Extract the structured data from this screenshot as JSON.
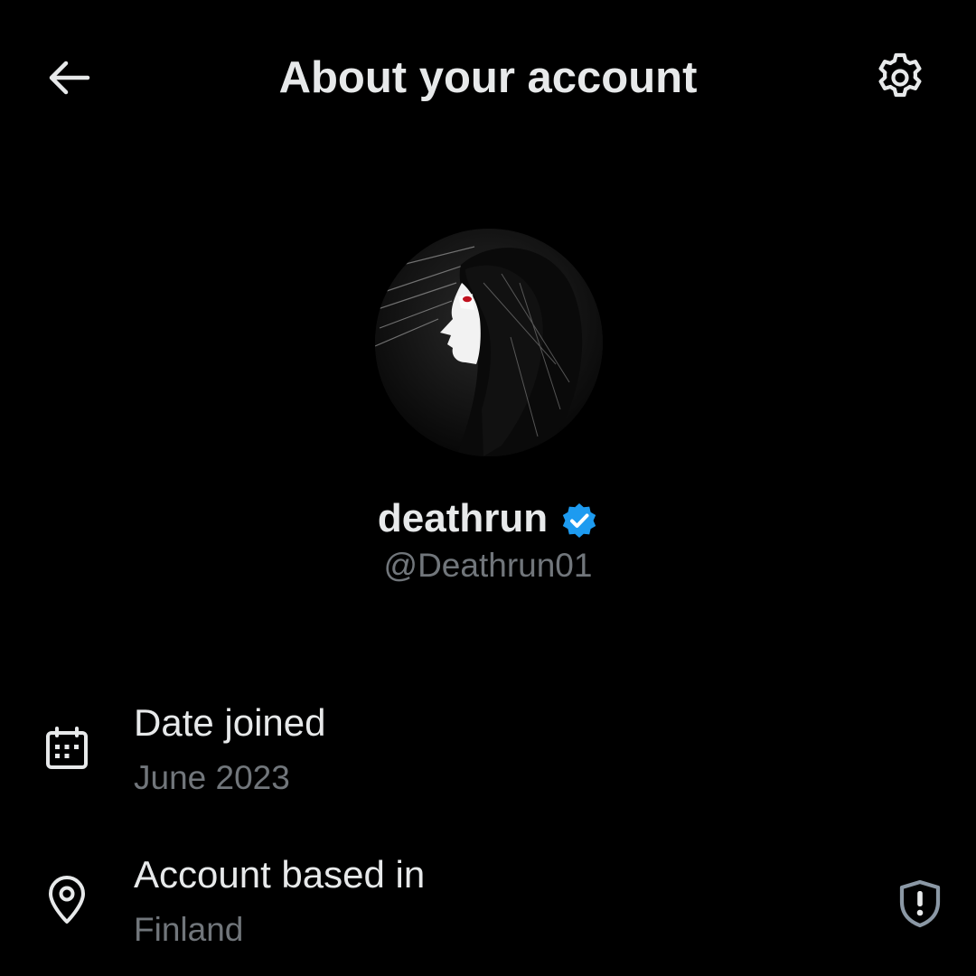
{
  "header": {
    "title": "About your account",
    "back_icon": "arrow-left-icon",
    "settings_icon": "gear-icon"
  },
  "profile": {
    "display_name": "deathrun",
    "handle": "@Deathrun01",
    "verified": true,
    "verified_color": "#1d9bf0",
    "avatar_icon": "profile-avatar"
  },
  "info": {
    "date_joined": {
      "label": "Date joined",
      "value": "June 2023",
      "icon": "calendar-icon"
    },
    "account_based_in": {
      "label": "Account based in",
      "value": "Finland",
      "icon": "location-pin-icon",
      "action_icon": "shield-alert-icon"
    }
  },
  "colors": {
    "background": "#000000",
    "primary_text": "#e7e9ea",
    "secondary_text": "#71767b",
    "accent": "#1d9bf0"
  }
}
